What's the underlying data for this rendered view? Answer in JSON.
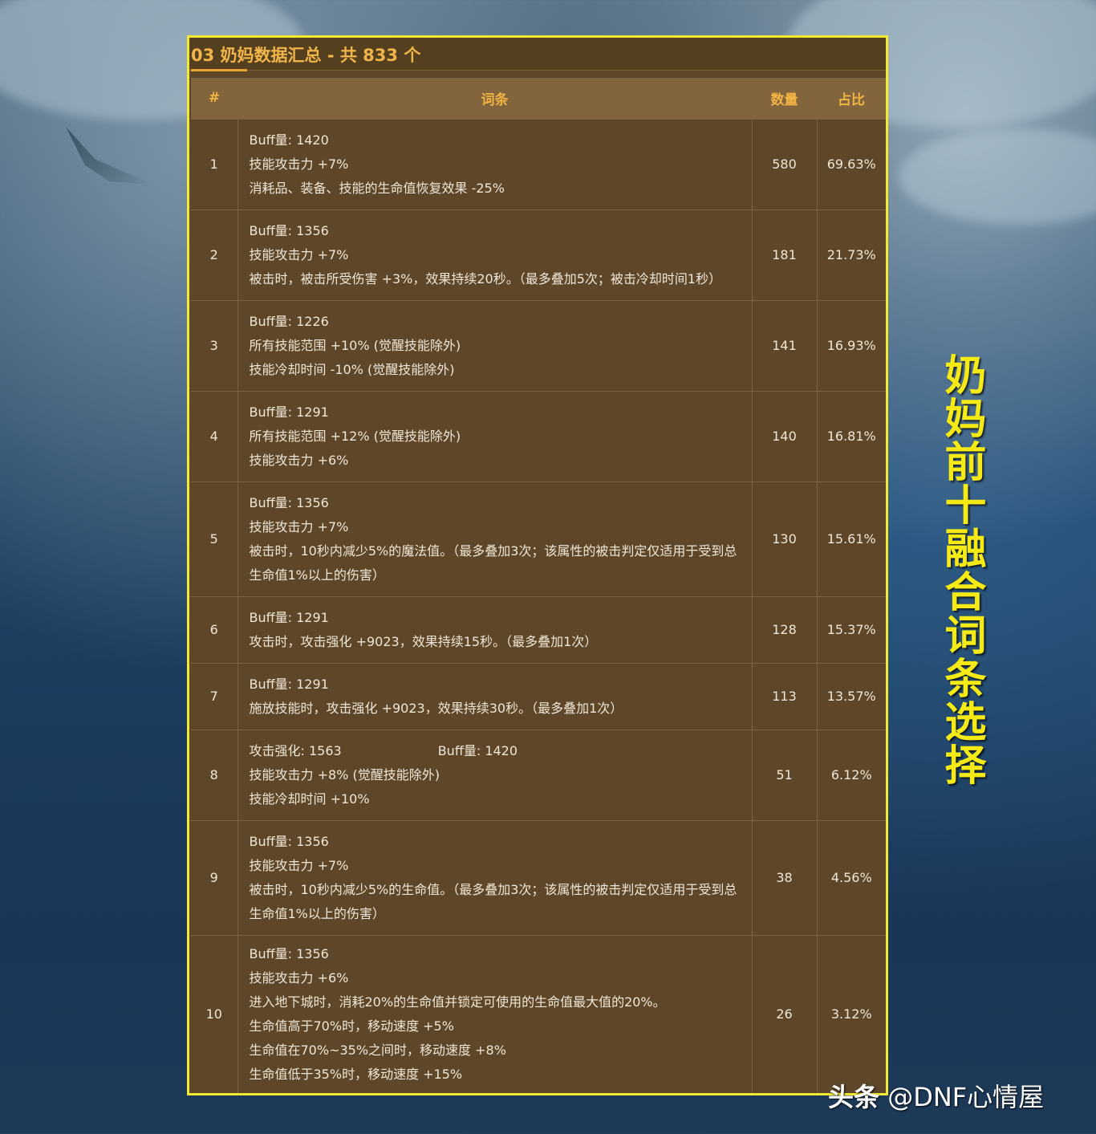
{
  "panel": {
    "title": "03 奶妈数据汇总 - 共 833 个",
    "headers": {
      "index": "#",
      "terms": "词条",
      "count": "数量",
      "ratio": "占比"
    },
    "rows": [
      {
        "index": "1",
        "lines": [
          "Buff量: 1420",
          "技能攻击力 +7%",
          "消耗品、装备、技能的生命值恢复效果 -25%"
        ],
        "count": "580",
        "ratio": "69.63%"
      },
      {
        "index": "2",
        "lines": [
          "Buff量: 1356",
          "技能攻击力 +7%",
          "被击时，被击所受伤害 +3%，效果持续20秒。（最多叠加5次；被击冷却时间1秒）"
        ],
        "count": "181",
        "ratio": "21.73%"
      },
      {
        "index": "3",
        "lines": [
          "Buff量: 1226",
          "所有技能范围 +10% (觉醒技能除外)",
          "技能冷却时间 -10% (觉醒技能除外)"
        ],
        "count": "141",
        "ratio": "16.93%"
      },
      {
        "index": "4",
        "lines": [
          "Buff量: 1291",
          "所有技能范围 +12% (觉醒技能除外)",
          "技能攻击力 +6%"
        ],
        "count": "140",
        "ratio": "16.81%"
      },
      {
        "index": "5",
        "lines": [
          "Buff量: 1356",
          "技能攻击力 +7%",
          "被击时，10秒内减少5%的魔法值。（最多叠加3次；该属性的被击判定仅适用于受到总生命值1%以上的伤害）"
        ],
        "count": "130",
        "ratio": "15.61%"
      },
      {
        "index": "6",
        "lines": [
          "Buff量: 1291",
          "攻击时，攻击强化 +9023，效果持续15秒。（最多叠加1次）"
        ],
        "count": "128",
        "ratio": "15.37%"
      },
      {
        "index": "7",
        "lines": [
          "Buff量: 1291",
          "施放技能时，攻击强化 +9023，效果持续30秒。（最多叠加1次）"
        ],
        "count": "113",
        "ratio": "13.57%"
      },
      {
        "index": "8",
        "pair": [
          "攻击强化: 1563",
          "Buff量: 1420"
        ],
        "lines": [
          "技能攻击力 +8% (觉醒技能除外)",
          "技能冷却时间 +10%"
        ],
        "count": "51",
        "ratio": "6.12%"
      },
      {
        "index": "9",
        "lines": [
          "Buff量: 1356",
          "技能攻击力 +7%",
          "被击时，10秒内减少5%的生命值。（最多叠加3次；该属性的被击判定仅适用于受到总生命值1%以上的伤害）"
        ],
        "count": "38",
        "ratio": "4.56%"
      },
      {
        "index": "10",
        "lines": [
          "Buff量: 1356",
          "技能攻击力 +6%",
          "进入地下城时，消耗20%的生命值并锁定可使用的生命值最大值的20%。",
          "生命值高于70%时，移动速度 +5%",
          "生命值在70%~35%之间时，移动速度 +8%",
          "生命值低于35%时，移动速度 +15%"
        ],
        "count": "26",
        "ratio": "3.12%"
      }
    ]
  },
  "side_title": "奶妈前十融合词条选择",
  "watermark": {
    "brand": "头条",
    "handle": " @DNF心情屋"
  },
  "colors": {
    "panel_bg": "#5e4729",
    "header_bg": "#82643d",
    "accent": "#f2b443",
    "border": "#f3e832",
    "side_title": "#f5ea16"
  }
}
